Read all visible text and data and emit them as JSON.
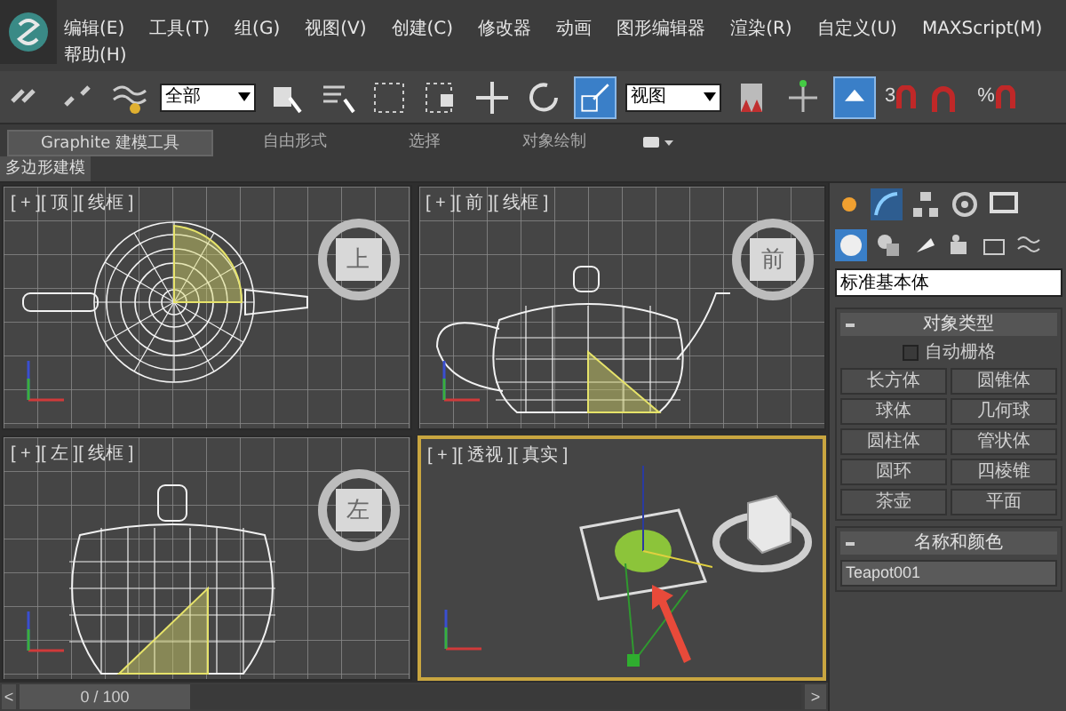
{
  "menu": [
    "编辑(E)",
    "工具(T)",
    "组(G)",
    "视图(V)",
    "创建(C)",
    "修改器",
    "动画",
    "图形编辑器",
    "渲染(R)",
    "自定义(U)",
    "MAXScript(M)",
    "帮助(H)"
  ],
  "toolbar": {
    "selection_filter": "全部",
    "coordinate_system": "视图",
    "snap_angle_label": "3",
    "snap_percent_label": "%"
  },
  "ribbon_tabs": [
    {
      "label": "Graphite 建模工具",
      "selected": true
    },
    {
      "label": "自由形式",
      "selected": false
    },
    {
      "label": "选择",
      "selected": false
    },
    {
      "label": "对象绘制",
      "selected": false
    }
  ],
  "ribbon_panel": "多边形建模",
  "viewports": [
    {
      "kind": "top",
      "label": "[ + ][ 顶 ][ 线框 ]",
      "cube_label": "上",
      "selected": false
    },
    {
      "kind": "front",
      "label": "[ + ][ 前 ][ 线框 ]",
      "cube_label": "前",
      "selected": false
    },
    {
      "kind": "left",
      "label": "[ + ][ 左 ][ 线框 ]",
      "cube_label": "左",
      "selected": false
    },
    {
      "kind": "perspective",
      "label": "[ + ][ 透视 ][ 真实 ]",
      "selected": true
    }
  ],
  "command_panel": {
    "category": "标准基本体",
    "object_type": {
      "title": "对象类型",
      "autogrid": {
        "label": "自动栅格",
        "checked": false
      },
      "buttons": [
        "长方体",
        "圆锥体",
        "球体",
        "几何球",
        "圆柱体",
        "管状体",
        "圆环",
        "四棱锥",
        "茶壶",
        "平面"
      ]
    },
    "name_color": {
      "title": "名称和颜色",
      "name": "Teapot001"
    }
  },
  "time_slider": {
    "prev": "<",
    "position": "0 / 100",
    "level": 0,
    "next": ">"
  }
}
